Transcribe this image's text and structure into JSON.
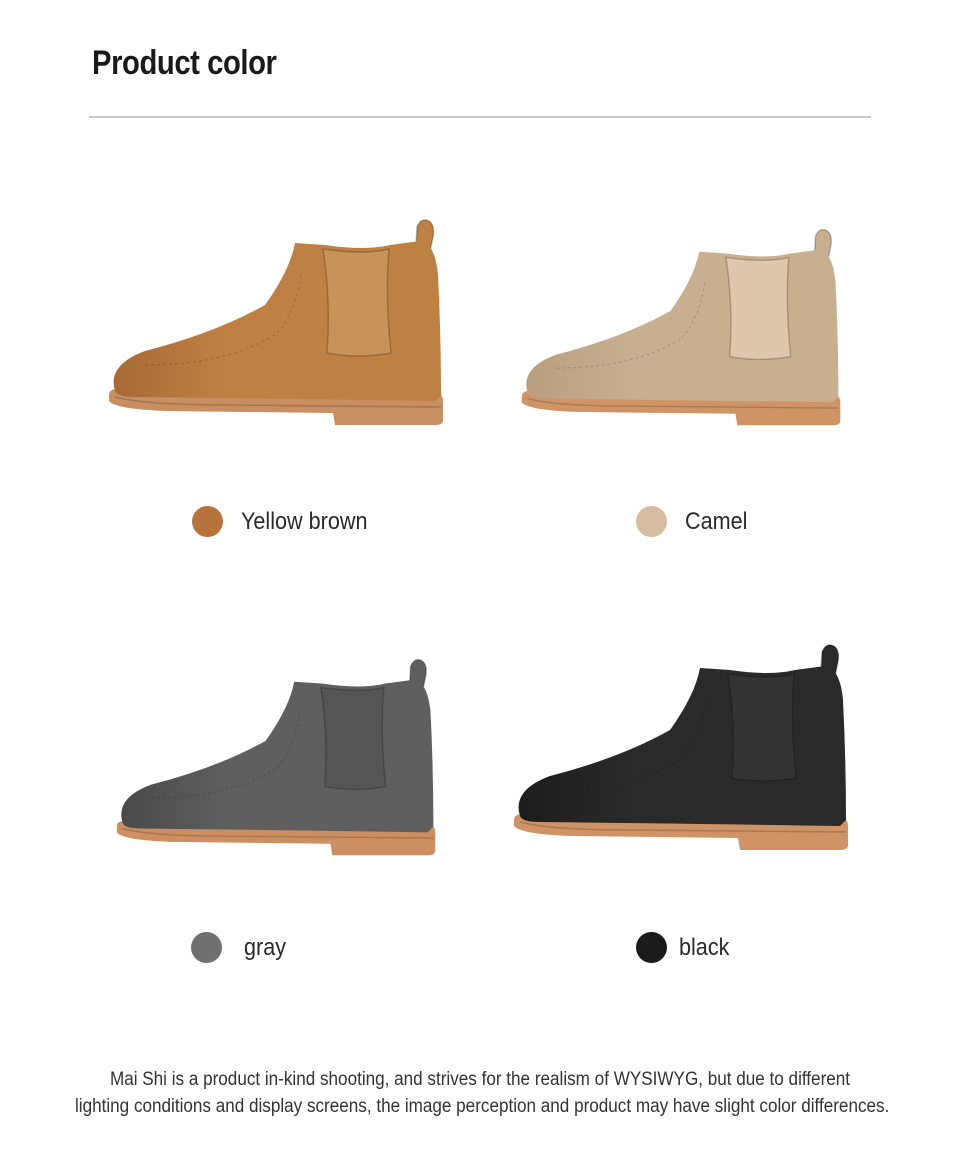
{
  "header": {
    "title": "Product color"
  },
  "products": [
    {
      "label": "Yellow brown",
      "swatch_color": "#b8733c",
      "upper_color": "#bf8143",
      "toe_color": "#a86a34",
      "elastic_color": "#c79358",
      "sole_color": "#c88f63"
    },
    {
      "label": "Camel",
      "swatch_color": "#d6bda2",
      "upper_color": "#c8af90",
      "toe_color": "#b99f80",
      "elastic_color": "#ddc8ad",
      "sole_color": "#cf9466"
    },
    {
      "label": "gray",
      "swatch_color": "#707070",
      "upper_color": "#5f5f5f",
      "toe_color": "#4a4a4a",
      "elastic_color": "#555555",
      "sole_color": "#cc8f62"
    },
    {
      "label": "black",
      "swatch_color": "#1b1b1b",
      "upper_color": "#2a2a2a",
      "toe_color": "#1c1c1c",
      "elastic_color": "#333333",
      "sole_color": "#cf9366"
    }
  ],
  "footer": {
    "line1": "Mai Shi is a product in-kind shooting, and strives for the realism of WYSIWYG, but due to different",
    "line2": "lighting conditions and display screens, the image perception and product may have slight color differences."
  }
}
